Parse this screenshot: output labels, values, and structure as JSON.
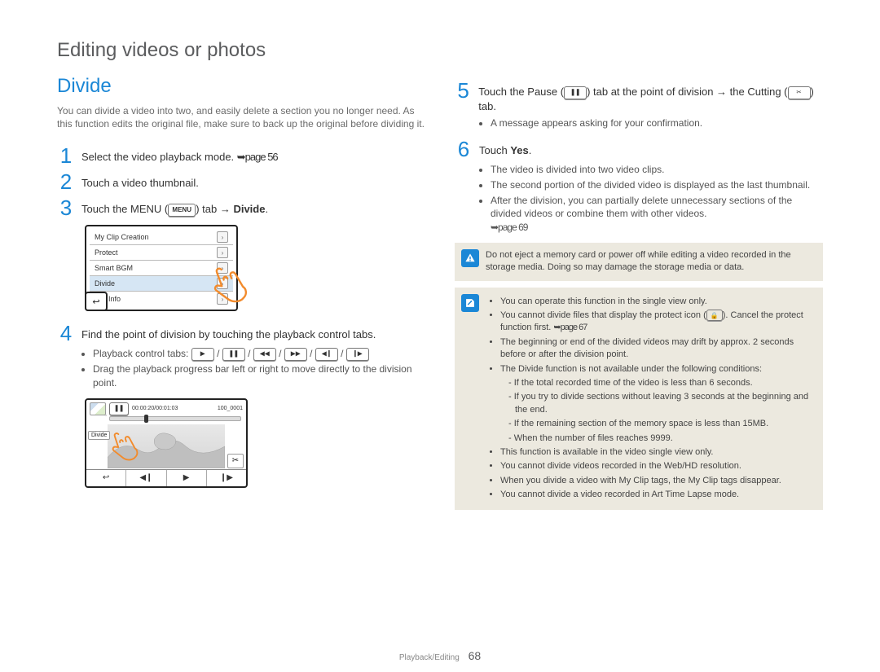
{
  "page_title": "Editing videos or photos",
  "section_heading": "Divide",
  "intro": "You can divide a video into two, and easily delete a section you no longer need. As this function edits the original file, make sure to back up the original before dividing it.",
  "steps_left": [
    {
      "num": "1",
      "text_a": "Select the video playback mode. ",
      "ref": "➥page 56"
    },
    {
      "num": "2",
      "text_a": "Touch a video thumbnail."
    },
    {
      "num": "3",
      "text_a": "Touch the MENU (",
      "tab_label": "MENU",
      "text_b": ") tab → ",
      "bold": "Divide",
      "text_c": "."
    },
    {
      "num": "4",
      "text_a": "Find the point of division by touching the playback control tabs."
    }
  ],
  "menu_shot": {
    "rows": [
      {
        "label": "My Clip Creation",
        "hl": false
      },
      {
        "label": "Protect",
        "hl": false
      },
      {
        "label": "Smart BGM",
        "hl": false
      },
      {
        "label": "Divide",
        "hl": true
      },
      {
        "label": "File Info",
        "hl": false
      }
    ],
    "back_glyph": "↩"
  },
  "step4_bullets": {
    "b1_prefix": "Playback control tabs: ",
    "controls": [
      "▶",
      "❚❚",
      "◀◀",
      "▶▶",
      "◀❙",
      "❙▶"
    ],
    "b2": "Drag the playback progress bar left or right to move directly to the division point."
  },
  "play_shot": {
    "pause_glyph": "❚❚",
    "counter": "00:00:20/00:01:03",
    "file": "100_0001",
    "divide_label": "Divide",
    "scissor_glyph": "✂",
    "controls": [
      "↩",
      "◀❙",
      "▶",
      "❙▶"
    ]
  },
  "steps_right": {
    "s5": {
      "num": "5",
      "text_a": "Touch the Pause (",
      "pause_glyph": "❚❚",
      "text_b": ") tab at the point of division → the Cutting (",
      "cut_glyph": "✂",
      "text_c": ") tab.",
      "bullet": "A message appears asking for your confirmation."
    },
    "s6": {
      "num": "6",
      "text_a": "Touch ",
      "bold": "Yes",
      "text_b": ".",
      "bullets": [
        "The video is divided into two video clips.",
        "The second portion of the divided video is displayed as the last thumbnail.",
        "After the division, you can partially delete unnecessary sections of the divided videos or combine them with other videos."
      ],
      "bullets_ref": "➥page 69"
    }
  },
  "warn_box": "Do not eject a memory card or power off while editing a video recorded in the storage media. Doing so may damage the storage media or data.",
  "info_box": {
    "items": [
      {
        "text": "You can operate this function in the single view only."
      },
      {
        "text_a": "You cannot divide files that display the protect icon (",
        "protect": true,
        "text_b": "). Cancel the protect function first. ",
        "ref": "➥page 67"
      },
      {
        "text": "The beginning or end of the divided videos may drift by approx. 2 seconds before or after the division point."
      },
      {
        "text": "The Divide function is not available under the following conditions:",
        "sub": [
          "If the total recorded time of the video is less than 6 seconds.",
          "If you try to divide sections without leaving 3 seconds at the beginning and the end.",
          "If the remaining section of the memory space is less than 15MB.",
          "When the number of files reaches 9999."
        ]
      },
      {
        "text": "This function is available in the video single view only."
      },
      {
        "text": "You cannot divide videos recorded in the Web/HD resolution."
      },
      {
        "text": "When you divide a video with My Clip tags, the My Clip tags disappear."
      },
      {
        "text": "You cannot divide a video recorded in Art Time Lapse mode."
      }
    ]
  },
  "footer": {
    "section": "Playback/Editing",
    "page_num": "68"
  }
}
